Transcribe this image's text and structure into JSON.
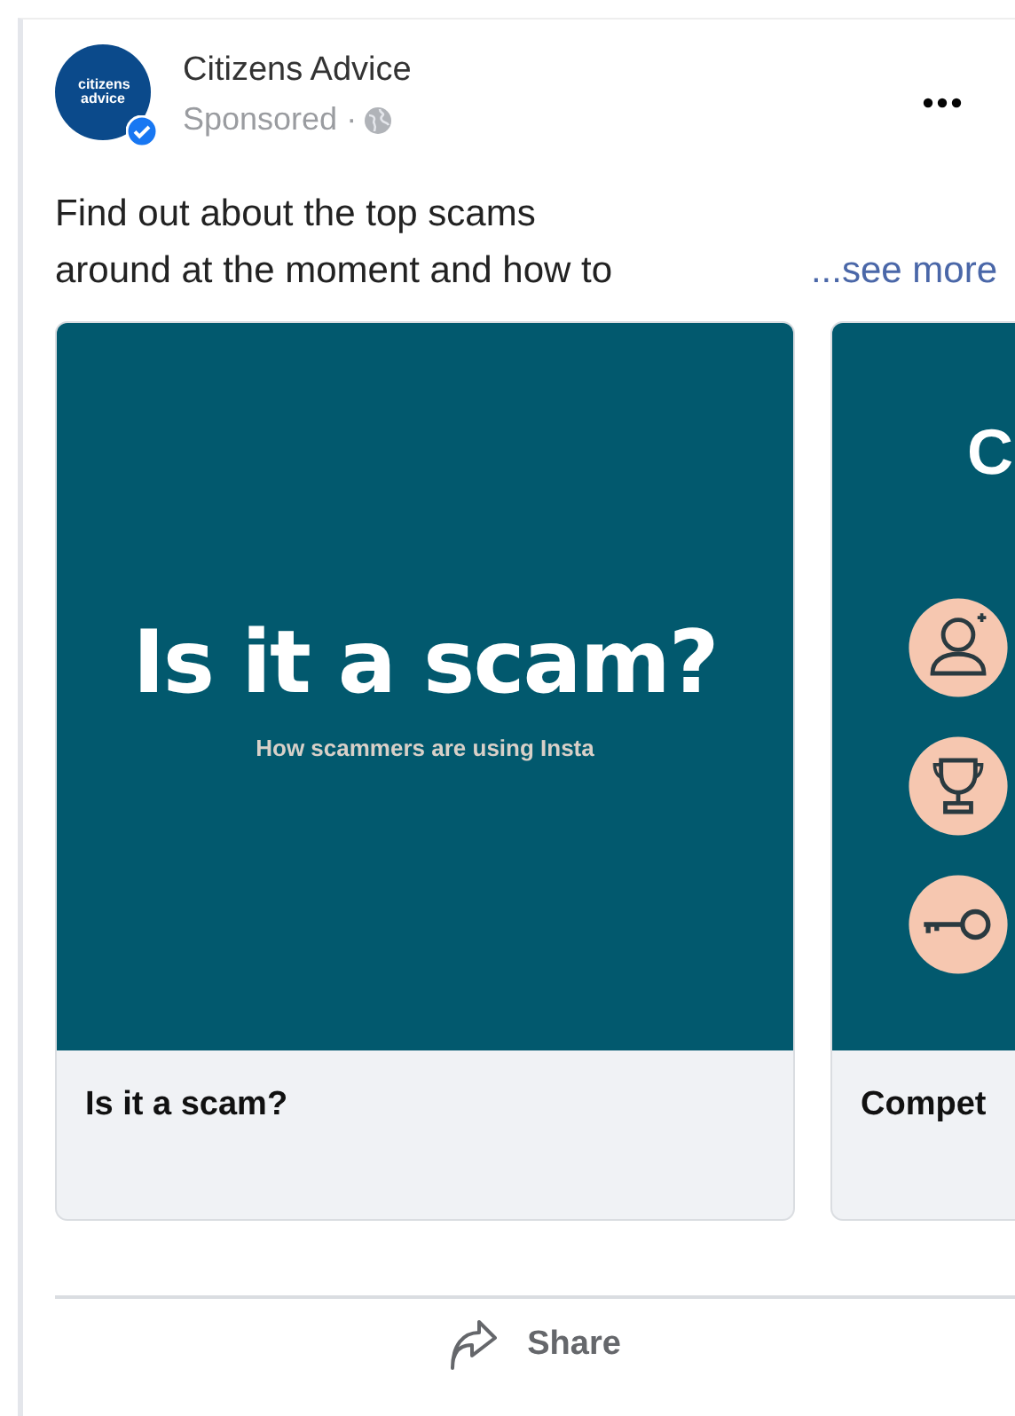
{
  "post": {
    "avatar_text": "citizens advice",
    "verified": true,
    "author": "Citizens Advice",
    "meta": "Sponsored ·",
    "text_lines": [
      "Find out about the top scams",
      "around at the moment and how to"
    ],
    "see_more": "...see more"
  },
  "cards": [
    {
      "kind": "title",
      "heading": "Is it a scam?",
      "subheading": "How scammers are using Insta",
      "caption": "Is it a scam?"
    },
    {
      "kind": "icons",
      "heading": "C",
      "icons": [
        {
          "kind": "person"
        },
        {
          "kind": "trophy"
        },
        {
          "kind": "key"
        }
      ],
      "caption": "Compet"
    }
  ],
  "actions": [
    {
      "label": "Share"
    }
  ]
}
